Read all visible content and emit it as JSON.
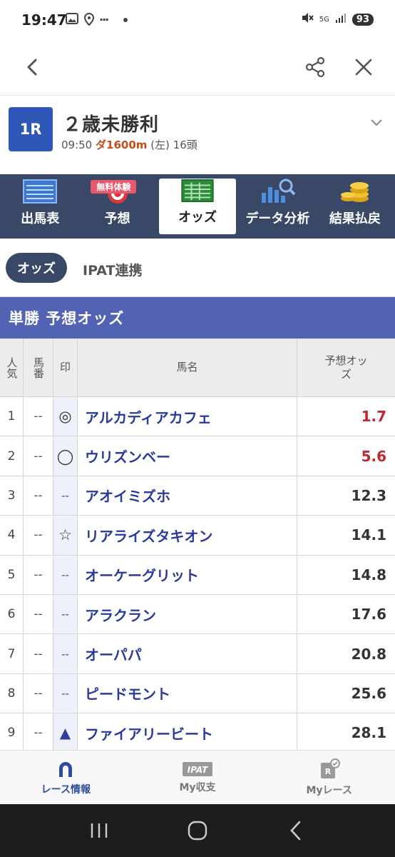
{
  "status_bar": {
    "time": "19:47",
    "signal_label": "5G",
    "battery": "93"
  },
  "header": {
    "back_icon": "chevron-left-icon",
    "share_icon": "share-icon",
    "close_icon": "close-icon"
  },
  "race": {
    "number": "1R",
    "name": "２歳未勝利",
    "time": "09:50",
    "course": "ダ1600m",
    "direction": "(左)",
    "runners": "16頭"
  },
  "tabs": [
    {
      "label": "出馬表",
      "icon": "entry-table-icon",
      "active": false
    },
    {
      "label": "予想",
      "icon": "target-icon",
      "active": false,
      "badge": "無料体験"
    },
    {
      "label": "オッズ",
      "icon": "odds-grid-icon",
      "active": true
    },
    {
      "label": "データ分析",
      "icon": "chart-search-icon",
      "active": false
    },
    {
      "label": "結果払戻",
      "icon": "coins-icon",
      "active": false
    }
  ],
  "subtabs": {
    "active": "オッズ",
    "other": "IPAT連携"
  },
  "section_title": "単勝 予想オッズ",
  "table": {
    "headers": {
      "rank": "人気",
      "num": "馬番",
      "mark": "印",
      "name": "馬名",
      "odds": "予想オッズ"
    },
    "rows": [
      {
        "rank": "1",
        "num": "--",
        "mark": "◎",
        "name": "アルカディアカフェ",
        "odds": "1.7",
        "hot": true
      },
      {
        "rank": "2",
        "num": "--",
        "mark": "◯",
        "name": "ウリズンベー",
        "odds": "5.6",
        "hot": true
      },
      {
        "rank": "3",
        "num": "--",
        "mark": "--",
        "name": "アオイミズホ",
        "odds": "12.3",
        "hot": false
      },
      {
        "rank": "4",
        "num": "--",
        "mark": "☆",
        "name": "リアライズタキオン",
        "odds": "14.1",
        "hot": false
      },
      {
        "rank": "5",
        "num": "--",
        "mark": "--",
        "name": "オーケーグリット",
        "odds": "14.8",
        "hot": false
      },
      {
        "rank": "6",
        "num": "--",
        "mark": "--",
        "name": "アラクラン",
        "odds": "17.6",
        "hot": false
      },
      {
        "rank": "7",
        "num": "--",
        "mark": "--",
        "name": "オーパパ",
        "odds": "20.8",
        "hot": false
      },
      {
        "rank": "8",
        "num": "--",
        "mark": "--",
        "name": "ピードモント",
        "odds": "25.6",
        "hot": false
      },
      {
        "rank": "9",
        "num": "--",
        "mark": "▲",
        "name": "ファイアリービート",
        "odds": "28.1",
        "hot": false
      }
    ]
  },
  "bottom_nav": [
    {
      "label": "レース情報",
      "icon": "horseshoe-icon",
      "active": true
    },
    {
      "label": "My収支",
      "icon": "ipat-icon",
      "icon_text": "IPAT",
      "active": false
    },
    {
      "label": "Myレース",
      "icon": "my-race-icon",
      "icon_text": "R",
      "active": false
    }
  ],
  "colors": {
    "tab_bar": "#3a4868",
    "section": "#5363b3",
    "race_badge": "#2e57b8",
    "odds_hot": "#c0282e",
    "horse_name": "#2a3a9c"
  }
}
